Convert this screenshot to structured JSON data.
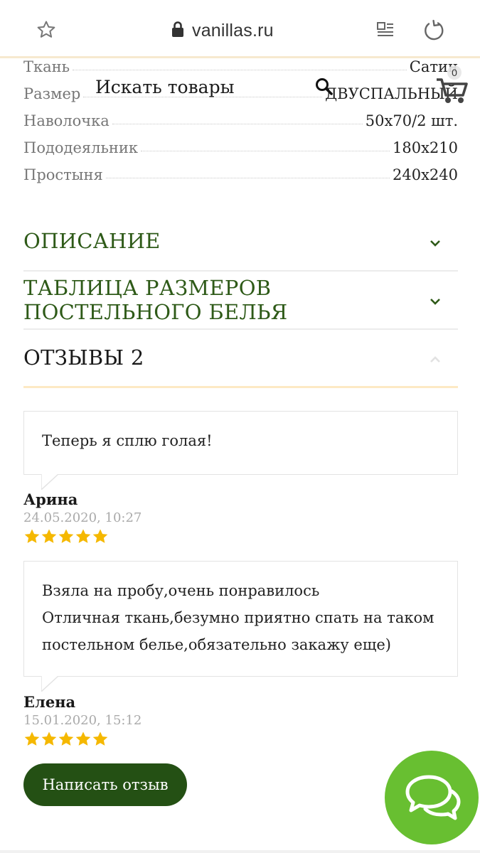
{
  "browser": {
    "url": "vanillas.ru",
    "icons": [
      "star-icon",
      "lock-icon",
      "reader-mode-icon",
      "reload-icon"
    ]
  },
  "search": {
    "placeholder": "Искать товары"
  },
  "cart": {
    "count": "0"
  },
  "specs": [
    {
      "label": "Ткань",
      "value": "Сатин"
    },
    {
      "label": "Размер",
      "value": "ДВУСПАЛЬНЫЙ"
    },
    {
      "label": "Наволочка",
      "value": "50x70/2 шт."
    },
    {
      "label": "Пододеяльник",
      "value": "180x210"
    },
    {
      "label": "Простыня",
      "value": "240x240"
    }
  ],
  "accordion": {
    "description": "ОПИСАНИЕ",
    "size_table": "ТАБЛИЦА РАЗМЕРОВ ПОСТЕЛЬНОГО БЕЛЬЯ",
    "reviews": "ОТЗЫВЫ 2"
  },
  "reviews": [
    {
      "text_lines": [
        "Теперь я сплю голая!"
      ],
      "author": "Арина",
      "date": "24.05.2020, 10:27",
      "rating": 5
    },
    {
      "text_lines": [
        "Взяла на пробу,очень понравилось",
        "Отличная ткань,безумно приятно спать на таком",
        "постельном белье,обязательно закажу еще)"
      ],
      "author": "Елена",
      "date": "15.01.2020, 15:12",
      "rating": 5
    }
  ],
  "write_review_label": "Написать отзыв",
  "colors": {
    "accent_green": "#2e5a18",
    "button_green": "#245014",
    "chat_green": "#68bf31",
    "star_gold": "#f5b800"
  }
}
